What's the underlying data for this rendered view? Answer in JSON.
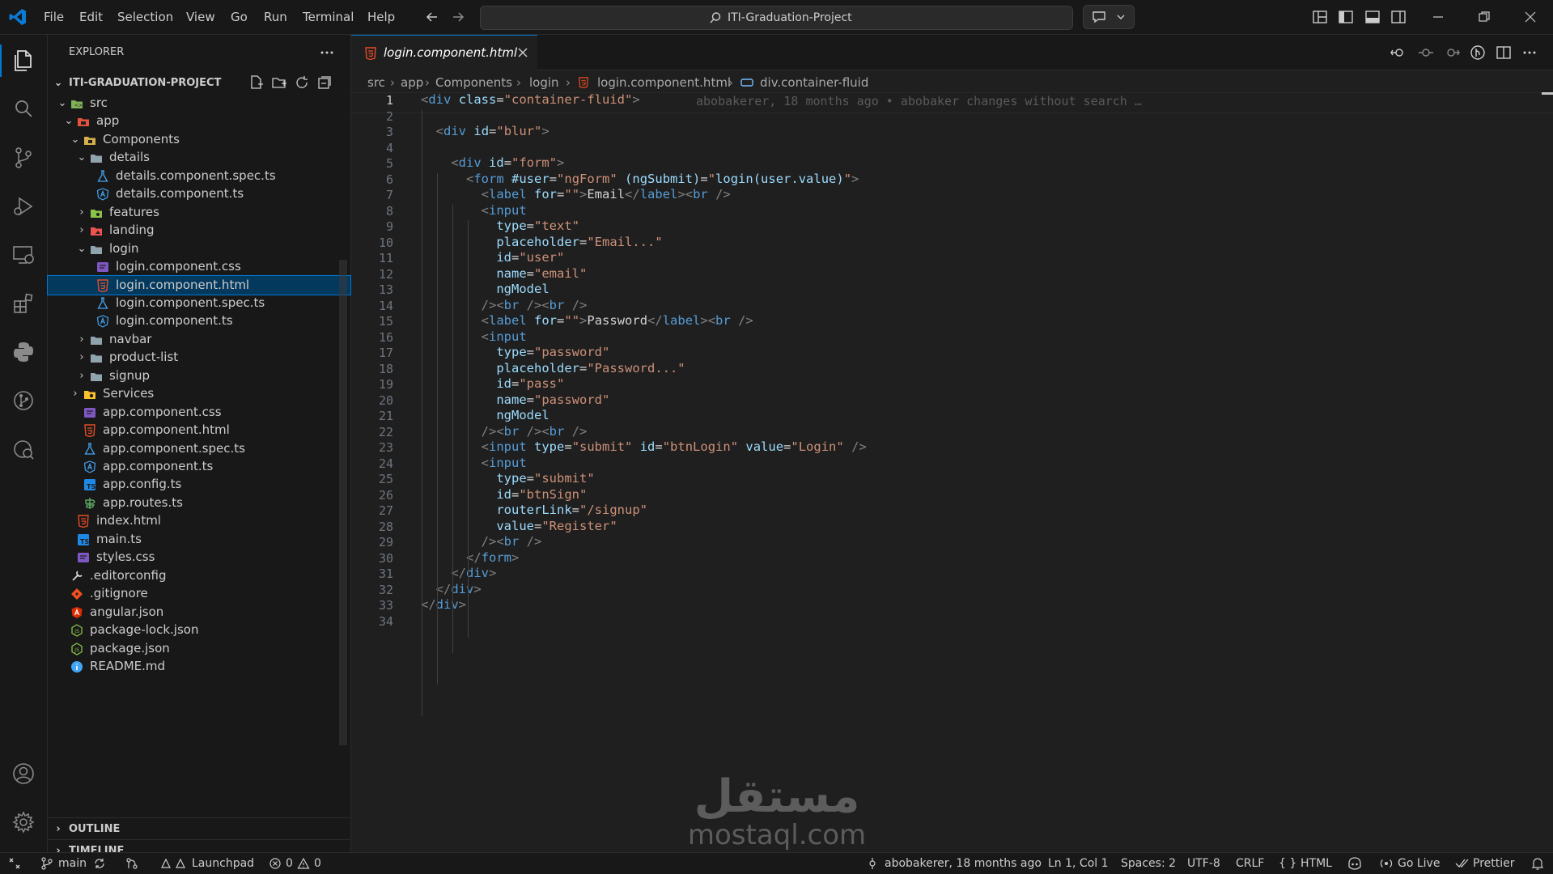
{
  "titlebar": {
    "menus": [
      "File",
      "Edit",
      "Selection",
      "View",
      "Go",
      "Run",
      "Terminal",
      "Help"
    ],
    "search_text": "ITI-Graduation-Project"
  },
  "explorer": {
    "title": "EXPLORER",
    "project": "ITI-GRADUATION-PROJECT",
    "tree": [
      {
        "label": "src",
        "depth": 1,
        "kind": "folder-open",
        "icon": "src-folder-icon"
      },
      {
        "label": "app",
        "depth": 2,
        "kind": "folder-open",
        "icon": "app-folder-icon"
      },
      {
        "label": "Components",
        "depth": 3,
        "kind": "folder-open",
        "icon": "components-folder-icon"
      },
      {
        "label": "details",
        "depth": 4,
        "kind": "folder-open",
        "icon": "folder-icon"
      },
      {
        "label": "details.component.spec.ts",
        "depth": 5,
        "kind": "file",
        "icon": "spec-file-icon"
      },
      {
        "label": "details.component.ts",
        "depth": 5,
        "kind": "file",
        "icon": "angular-file-icon"
      },
      {
        "label": "features",
        "depth": 4,
        "kind": "folder",
        "icon": "features-folder-icon"
      },
      {
        "label": "landing",
        "depth": 4,
        "kind": "folder",
        "icon": "landing-folder-icon"
      },
      {
        "label": "login",
        "depth": 4,
        "kind": "folder-open",
        "icon": "folder-icon"
      },
      {
        "label": "login.component.css",
        "depth": 5,
        "kind": "file",
        "icon": "css-file-icon"
      },
      {
        "label": "login.component.html",
        "depth": 5,
        "kind": "file",
        "icon": "html-file-icon",
        "selected": true
      },
      {
        "label": "login.component.spec.ts",
        "depth": 5,
        "kind": "file",
        "icon": "spec-file-icon"
      },
      {
        "label": "login.component.ts",
        "depth": 5,
        "kind": "file",
        "icon": "angular-file-icon"
      },
      {
        "label": "navbar",
        "depth": 4,
        "kind": "folder",
        "icon": "folder-icon"
      },
      {
        "label": "product-list",
        "depth": 4,
        "kind": "folder",
        "icon": "folder-icon"
      },
      {
        "label": "signup",
        "depth": 4,
        "kind": "folder",
        "icon": "folder-icon"
      },
      {
        "label": "Services",
        "depth": 3,
        "kind": "folder",
        "icon": "services-folder-icon"
      },
      {
        "label": "app.component.css",
        "depth": 3,
        "kind": "file",
        "icon": "css-file-icon"
      },
      {
        "label": "app.component.html",
        "depth": 3,
        "kind": "file",
        "icon": "html-file-icon"
      },
      {
        "label": "app.component.spec.ts",
        "depth": 3,
        "kind": "file",
        "icon": "spec-file-icon"
      },
      {
        "label": "app.component.ts",
        "depth": 3,
        "kind": "file",
        "icon": "angular-file-icon"
      },
      {
        "label": "app.config.ts",
        "depth": 3,
        "kind": "file",
        "icon": "ts-file-icon"
      },
      {
        "label": "app.routes.ts",
        "depth": 3,
        "kind": "file",
        "icon": "routes-file-icon"
      },
      {
        "label": "index.html",
        "depth": 2,
        "kind": "file",
        "icon": "html-file-icon"
      },
      {
        "label": "main.ts",
        "depth": 2,
        "kind": "file",
        "icon": "ts-file-icon"
      },
      {
        "label": "styles.css",
        "depth": 2,
        "kind": "file",
        "icon": "css-file-icon"
      },
      {
        "label": ".editorconfig",
        "depth": 1,
        "kind": "file",
        "icon": "editorconfig-file-icon"
      },
      {
        "label": ".gitignore",
        "depth": 1,
        "kind": "file",
        "icon": "git-file-icon"
      },
      {
        "label": "angular.json",
        "depth": 1,
        "kind": "file",
        "icon": "angular-json-icon"
      },
      {
        "label": "package-lock.json",
        "depth": 1,
        "kind": "file",
        "icon": "npm-file-icon"
      },
      {
        "label": "package.json",
        "depth": 1,
        "kind": "file",
        "icon": "npm-file-icon"
      },
      {
        "label": "README.md",
        "depth": 1,
        "kind": "file",
        "icon": "info-file-icon"
      }
    ],
    "outline": "OUTLINE",
    "timeline": "TIMELINE"
  },
  "editor": {
    "tab_label": "login.component.html",
    "breadcrumb": [
      "src",
      "app",
      "Components",
      "login",
      "login.component.html",
      "div.container-fluid"
    ],
    "blame": "abobakerer, 18 months ago • abobaker changes without search …",
    "lines": [
      [
        [
          "t",
          "<"
        ],
        [
          "tag",
          "div"
        ],
        [
          "tx",
          " "
        ],
        [
          "at",
          "class"
        ],
        [
          "tx",
          "="
        ],
        [
          "s",
          "\"container-fluid\""
        ],
        [
          "t",
          ">"
        ]
      ],
      [],
      [
        [
          "tx",
          "  "
        ],
        [
          "t",
          "<"
        ],
        [
          "tag",
          "div"
        ],
        [
          "tx",
          " "
        ],
        [
          "at",
          "id"
        ],
        [
          "tx",
          "="
        ],
        [
          "s",
          "\"blur\""
        ],
        [
          "t",
          ">"
        ]
      ],
      [],
      [
        [
          "tx",
          "    "
        ],
        [
          "t",
          "<"
        ],
        [
          "tag",
          "div"
        ],
        [
          "tx",
          " "
        ],
        [
          "at",
          "id"
        ],
        [
          "tx",
          "="
        ],
        [
          "s",
          "\"form\""
        ],
        [
          "t",
          ">"
        ]
      ],
      [
        [
          "tx",
          "      "
        ],
        [
          "t",
          "<"
        ],
        [
          "tag",
          "form"
        ],
        [
          "tx",
          " "
        ],
        [
          "at",
          "#user"
        ],
        [
          "tx",
          "="
        ],
        [
          "s",
          "\"ngForm\""
        ],
        [
          "tx",
          " "
        ],
        [
          "at",
          "(ngSubmit)"
        ],
        [
          "tx",
          "="
        ],
        [
          "s",
          "\""
        ],
        [
          "at",
          "login(user.value)"
        ],
        [
          "s",
          "\""
        ],
        [
          "t",
          ">"
        ]
      ],
      [
        [
          "tx",
          "        "
        ],
        [
          "t",
          "<"
        ],
        [
          "tag",
          "label"
        ],
        [
          "tx",
          " "
        ],
        [
          "at",
          "for"
        ],
        [
          "tx",
          "="
        ],
        [
          "s",
          "\"\""
        ],
        [
          "t",
          ">"
        ],
        [
          "tx",
          "Email"
        ],
        [
          "t",
          "</"
        ],
        [
          "tag",
          "label"
        ],
        [
          "t",
          "><"
        ],
        [
          "tag",
          "br"
        ],
        [
          "tx",
          " "
        ],
        [
          "t",
          "/>"
        ]
      ],
      [
        [
          "tx",
          "        "
        ],
        [
          "t",
          "<"
        ],
        [
          "tag",
          "input"
        ]
      ],
      [
        [
          "tx",
          "          "
        ],
        [
          "at",
          "type"
        ],
        [
          "tx",
          "="
        ],
        [
          "s",
          "\"text\""
        ]
      ],
      [
        [
          "tx",
          "          "
        ],
        [
          "at",
          "placeholder"
        ],
        [
          "tx",
          "="
        ],
        [
          "s",
          "\"Email...\""
        ]
      ],
      [
        [
          "tx",
          "          "
        ],
        [
          "at",
          "id"
        ],
        [
          "tx",
          "="
        ],
        [
          "s",
          "\"user\""
        ]
      ],
      [
        [
          "tx",
          "          "
        ],
        [
          "at",
          "name"
        ],
        [
          "tx",
          "="
        ],
        [
          "s",
          "\"email\""
        ]
      ],
      [
        [
          "tx",
          "          "
        ],
        [
          "at",
          "ngModel"
        ]
      ],
      [
        [
          "tx",
          "        "
        ],
        [
          "t",
          "/><"
        ],
        [
          "tag",
          "br"
        ],
        [
          "tx",
          " "
        ],
        [
          "t",
          "/><"
        ],
        [
          "tag",
          "br"
        ],
        [
          "tx",
          " "
        ],
        [
          "t",
          "/>"
        ]
      ],
      [
        [
          "tx",
          "        "
        ],
        [
          "t",
          "<"
        ],
        [
          "tag",
          "label"
        ],
        [
          "tx",
          " "
        ],
        [
          "at",
          "for"
        ],
        [
          "tx",
          "="
        ],
        [
          "s",
          "\"\""
        ],
        [
          "t",
          ">"
        ],
        [
          "tx",
          "Password"
        ],
        [
          "t",
          "</"
        ],
        [
          "tag",
          "label"
        ],
        [
          "t",
          "><"
        ],
        [
          "tag",
          "br"
        ],
        [
          "tx",
          " "
        ],
        [
          "t",
          "/>"
        ]
      ],
      [
        [
          "tx",
          "        "
        ],
        [
          "t",
          "<"
        ],
        [
          "tag",
          "input"
        ]
      ],
      [
        [
          "tx",
          "          "
        ],
        [
          "at",
          "type"
        ],
        [
          "tx",
          "="
        ],
        [
          "s",
          "\"password\""
        ]
      ],
      [
        [
          "tx",
          "          "
        ],
        [
          "at",
          "placeholder"
        ],
        [
          "tx",
          "="
        ],
        [
          "s",
          "\"Password...\""
        ]
      ],
      [
        [
          "tx",
          "          "
        ],
        [
          "at",
          "id"
        ],
        [
          "tx",
          "="
        ],
        [
          "s",
          "\"pass\""
        ]
      ],
      [
        [
          "tx",
          "          "
        ],
        [
          "at",
          "name"
        ],
        [
          "tx",
          "="
        ],
        [
          "s",
          "\"password\""
        ]
      ],
      [
        [
          "tx",
          "          "
        ],
        [
          "at",
          "ngModel"
        ]
      ],
      [
        [
          "tx",
          "        "
        ],
        [
          "t",
          "/><"
        ],
        [
          "tag",
          "br"
        ],
        [
          "tx",
          " "
        ],
        [
          "t",
          "/><"
        ],
        [
          "tag",
          "br"
        ],
        [
          "tx",
          " "
        ],
        [
          "t",
          "/>"
        ]
      ],
      [
        [
          "tx",
          "        "
        ],
        [
          "t",
          "<"
        ],
        [
          "tag",
          "input"
        ],
        [
          "tx",
          " "
        ],
        [
          "at",
          "type"
        ],
        [
          "tx",
          "="
        ],
        [
          "s",
          "\"submit\""
        ],
        [
          "tx",
          " "
        ],
        [
          "at",
          "id"
        ],
        [
          "tx",
          "="
        ],
        [
          "s",
          "\"btnLogin\""
        ],
        [
          "tx",
          " "
        ],
        [
          "at",
          "value"
        ],
        [
          "tx",
          "="
        ],
        [
          "s",
          "\"Login\""
        ],
        [
          "tx",
          " "
        ],
        [
          "t",
          "/>"
        ]
      ],
      [
        [
          "tx",
          "        "
        ],
        [
          "t",
          "<"
        ],
        [
          "tag",
          "input"
        ]
      ],
      [
        [
          "tx",
          "          "
        ],
        [
          "at",
          "type"
        ],
        [
          "tx",
          "="
        ],
        [
          "s",
          "\"submit\""
        ]
      ],
      [
        [
          "tx",
          "          "
        ],
        [
          "at",
          "id"
        ],
        [
          "tx",
          "="
        ],
        [
          "s",
          "\"btnSign\""
        ]
      ],
      [
        [
          "tx",
          "          "
        ],
        [
          "at",
          "routerLink"
        ],
        [
          "tx",
          "="
        ],
        [
          "s",
          "\"/signup\""
        ]
      ],
      [
        [
          "tx",
          "          "
        ],
        [
          "at",
          "value"
        ],
        [
          "tx",
          "="
        ],
        [
          "s",
          "\"Register\""
        ]
      ],
      [
        [
          "tx",
          "        "
        ],
        [
          "t",
          "/><"
        ],
        [
          "tag",
          "br"
        ],
        [
          "tx",
          " "
        ],
        [
          "t",
          "/>"
        ]
      ],
      [
        [
          "tx",
          "      "
        ],
        [
          "t",
          "</"
        ],
        [
          "tag",
          "form"
        ],
        [
          "t",
          ">"
        ]
      ],
      [
        [
          "tx",
          "    "
        ],
        [
          "t",
          "</"
        ],
        [
          "tag",
          "div"
        ],
        [
          "t",
          ">"
        ]
      ],
      [
        [
          "tx",
          "  "
        ],
        [
          "t",
          "</"
        ],
        [
          "tag",
          "div"
        ],
        [
          "t",
          ">"
        ]
      ],
      [
        [
          "t",
          "</"
        ],
        [
          "tag",
          "div"
        ],
        [
          "t",
          ">"
        ]
      ],
      []
    ]
  },
  "status": {
    "branch": "main",
    "launchpad": "Launchpad",
    "errors": "0",
    "warnings": "0",
    "blame": "abobakerer, 18 months ago",
    "position": "Ln 1, Col 1",
    "spaces": "Spaces: 2",
    "encoding": "UTF-8",
    "eol": "CRLF",
    "language": "HTML",
    "golive": "Go Live",
    "prettier": "Prettier"
  },
  "watermark": {
    "arabic": "مستقل",
    "latin": "mostaql.com"
  },
  "colors": {
    "accent": "#0078d4",
    "selection": "#04395e",
    "tag": "#569cd6",
    "attr": "#9cdcfe",
    "string": "#ce9178"
  }
}
